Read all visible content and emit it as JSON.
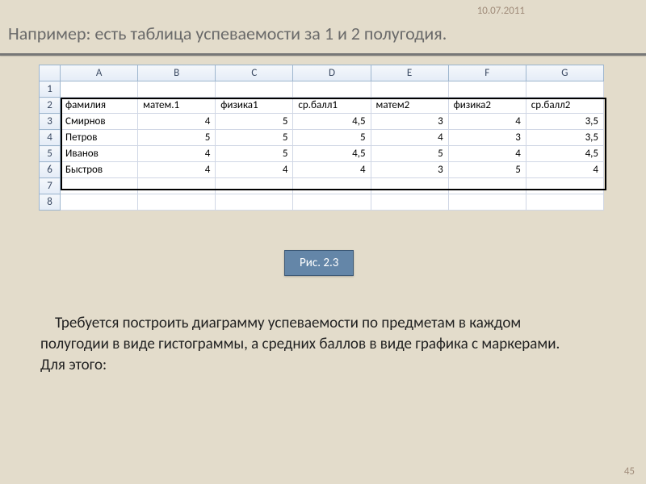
{
  "date": "10.07.2011",
  "title": "Например: есть таблица успеваемости за 1 и 2 полугодия.",
  "caption": "Рис. 2.3",
  "body_text": "Требуется построить диаграмму успеваемости по предметам в каждом полугодии в виде гистограммы, а средних баллов в виде графика с маркерами. Для этого:",
  "page_number": "45",
  "excel": {
    "columns": [
      "A",
      "B",
      "C",
      "D",
      "E",
      "F",
      "G"
    ],
    "row_numbers": [
      "1",
      "2",
      "3",
      "4",
      "5",
      "6",
      "7",
      "8"
    ],
    "headers": [
      "фамилия",
      "матем.1",
      "физика1",
      "ср.балл1",
      "матем2",
      "физика2",
      "ср.балл2"
    ],
    "rows": [
      {
        "name": "Смирнов",
        "v": [
          "4",
          "5",
          "4,5",
          "3",
          "4",
          "3,5"
        ]
      },
      {
        "name": "Петров",
        "v": [
          "5",
          "5",
          "5",
          "4",
          "3",
          "3,5"
        ]
      },
      {
        "name": "Иванов",
        "v": [
          "4",
          "5",
          "4,5",
          "5",
          "4",
          "4,5"
        ]
      },
      {
        "name": "Быстров",
        "v": [
          "4",
          "4",
          "4",
          "3",
          "5",
          "4"
        ]
      }
    ]
  }
}
